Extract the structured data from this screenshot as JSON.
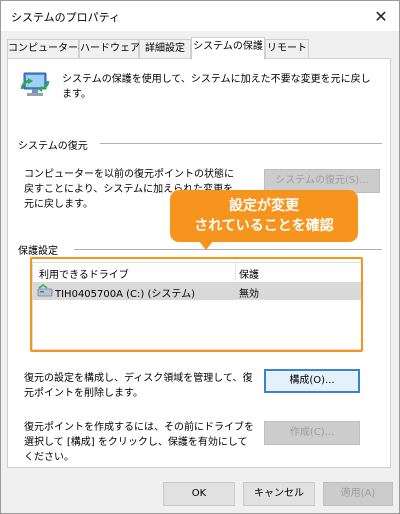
{
  "window": {
    "title": "システムのプロパティ",
    "close_glyph": "✕"
  },
  "tabs": [
    {
      "label": "コンピューター名"
    },
    {
      "label": "ハードウェア"
    },
    {
      "label": "詳細設定"
    },
    {
      "label": "システムの保護",
      "active": true
    },
    {
      "label": "リモート"
    }
  ],
  "intro": {
    "text": "システムの保護を使用して、システムに加えた不要な変更を元に戻します。",
    "icon": "system-protection-icon"
  },
  "restore": {
    "group_title": "システムの復元",
    "description": "コンピューターを以前の復元ポイントの状態に戻すことにより、システムに加えられた変更を元に戻します。",
    "button_label": "システムの復元(S)..."
  },
  "protection": {
    "group_title": "保護設定",
    "columns": [
      "利用できるドライブ",
      "保護"
    ],
    "rows": [
      {
        "drive": "TIH0405700A (C:) (システム)",
        "status": "無効",
        "icon": "drive-icon"
      }
    ]
  },
  "configure": {
    "description": "復元の設定を構成し、ディスク領域を管理して、復元ポイントを削除します。",
    "button_label": "構成(O)..."
  },
  "create": {
    "description": "復元ポイントを作成するには、その前にドライブを選択して [構成] をクリックし、保護を有効にしてください。",
    "button_label": "作成(C)..."
  },
  "footer": {
    "ok_label": "OK",
    "cancel_label": "キャンセル",
    "apply_label": "適用(A)"
  },
  "annotation": {
    "line1": "設定が変更",
    "line2": "されていることを確認",
    "color": "#f7941d"
  }
}
